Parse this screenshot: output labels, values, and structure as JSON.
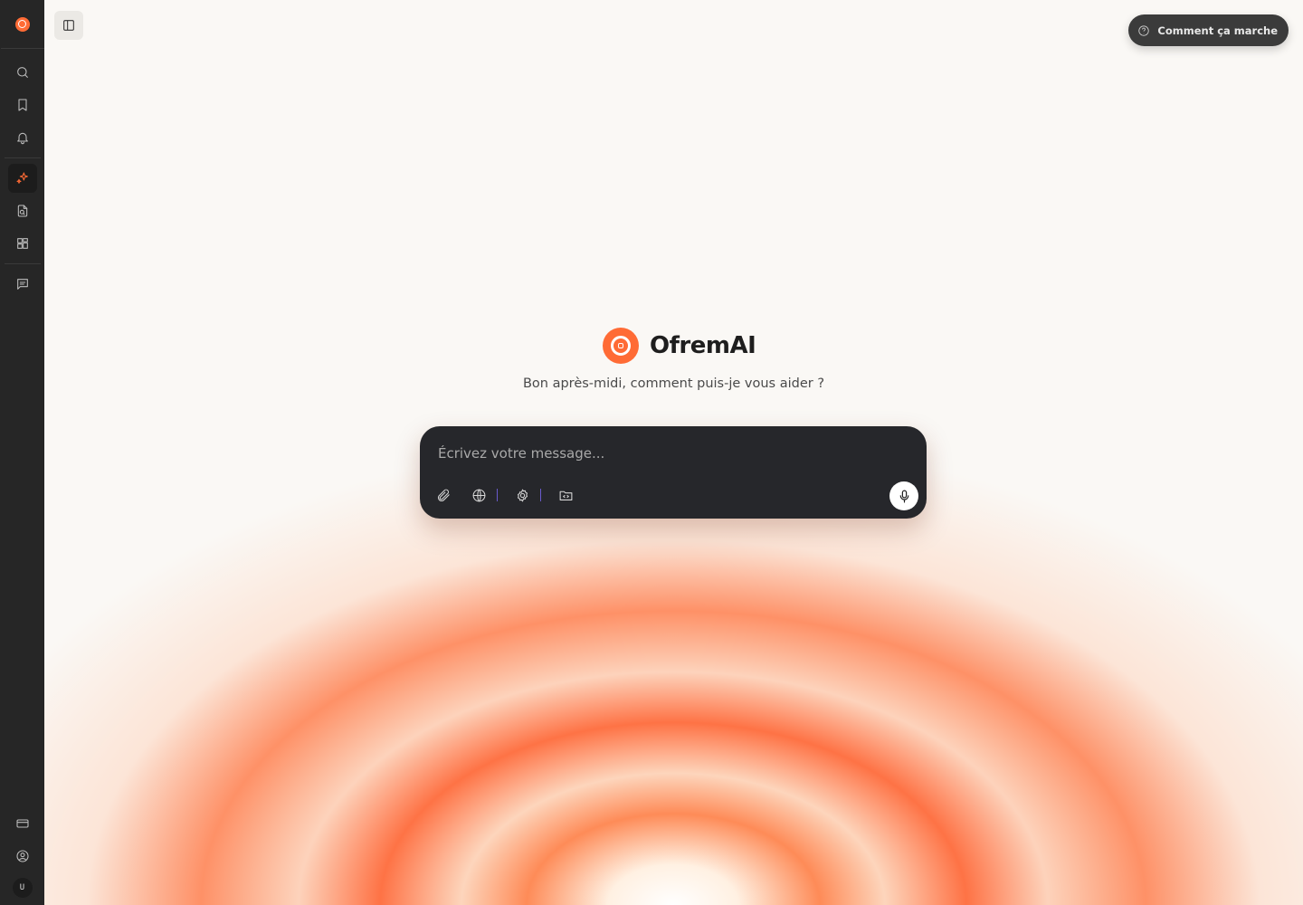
{
  "app": {
    "brand_name": "OfremAI",
    "greeting": "Bon après-midi, comment puis-je vous aider ?",
    "accent_color": "#ff6b35"
  },
  "sidebar": {
    "items": [
      {
        "icon": "search-icon"
      },
      {
        "icon": "bookmark-icon"
      },
      {
        "icon": "bell-icon"
      },
      {
        "icon": "sparkles-icon",
        "active": true
      },
      {
        "icon": "file-search-icon"
      },
      {
        "icon": "grid-icon"
      },
      {
        "icon": "message-icon"
      }
    ],
    "bottom_items": [
      {
        "icon": "credit-card-icon"
      },
      {
        "icon": "user-circle-icon"
      }
    ],
    "avatar_initial": "U"
  },
  "header": {
    "help_button_label": "Comment ça marche"
  },
  "composer": {
    "placeholder": "Écrivez votre message...",
    "value": "",
    "tools": [
      "paperclip-icon",
      "globe-icon",
      "settings-icon",
      "folder-code-icon"
    ],
    "mic_icon": "microphone-icon"
  }
}
